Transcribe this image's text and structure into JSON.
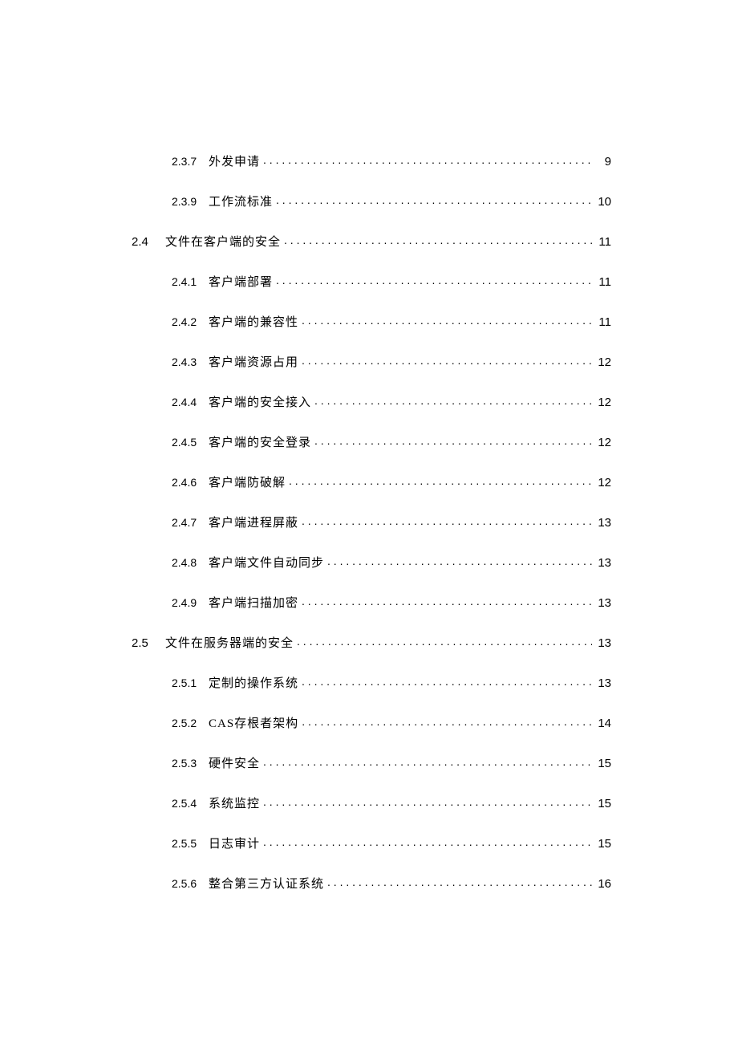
{
  "toc": [
    {
      "level": 2,
      "num": "2.3.7",
      "title": "外发申请",
      "page": "9"
    },
    {
      "level": 2,
      "num": "2.3.9",
      "title": "工作流标准",
      "page": "10"
    },
    {
      "level": 1,
      "num": "2.4",
      "title": "文件在客户端的安全",
      "page": "11"
    },
    {
      "level": 2,
      "num": "2.4.1",
      "title": "客户端部署",
      "page": "11"
    },
    {
      "level": 2,
      "num": "2.4.2",
      "title": "客户端的兼容性",
      "page": "11"
    },
    {
      "level": 2,
      "num": "2.4.3",
      "title": "客户端资源占用",
      "page": "12"
    },
    {
      "level": 2,
      "num": "2.4.4",
      "title": "客户端的安全接入",
      "page": "12"
    },
    {
      "level": 2,
      "num": "2.4.5",
      "title": "客户端的安全登录",
      "page": "12"
    },
    {
      "level": 2,
      "num": "2.4.6",
      "title": "客户端防破解",
      "page": "12"
    },
    {
      "level": 2,
      "num": "2.4.7",
      "title": "客户端进程屏蔽",
      "page": "13"
    },
    {
      "level": 2,
      "num": "2.4.8",
      "title": "客户端文件自动同步",
      "page": "13"
    },
    {
      "level": 2,
      "num": "2.4.9",
      "title": "客户端扫描加密",
      "page": "13"
    },
    {
      "level": 1,
      "num": "2.5",
      "title": "文件在服务器端的安全",
      "page": "13"
    },
    {
      "level": 2,
      "num": "2.5.1",
      "title": "定制的操作系统",
      "page": "13"
    },
    {
      "level": 2,
      "num": "2.5.2",
      "title": "CAS存根者架构",
      "page": "14"
    },
    {
      "level": 2,
      "num": "2.5.3",
      "title": "硬件安全",
      "page": "15"
    },
    {
      "level": 2,
      "num": "2.5.4",
      "title": "系统监控",
      "page": "15"
    },
    {
      "level": 2,
      "num": "2.5.5",
      "title": "日志审计",
      "page": "15"
    },
    {
      "level": 2,
      "num": "2.5.6",
      "title": "整合第三方认证系统",
      "page": "16"
    }
  ]
}
